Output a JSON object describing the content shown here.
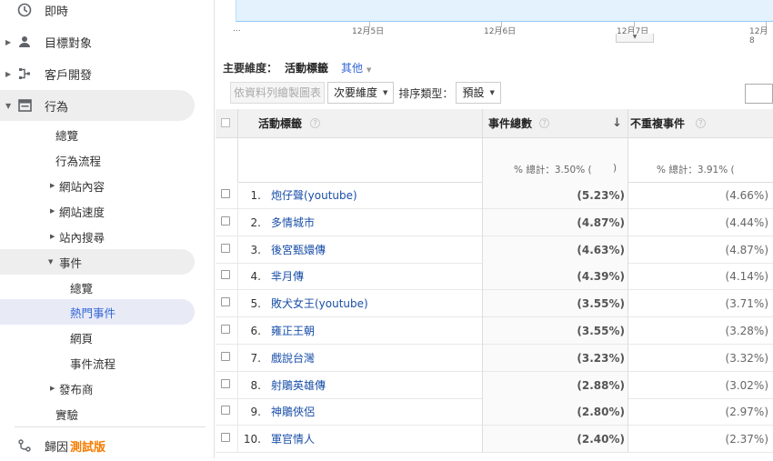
{
  "sidebar": {
    "top_items": [
      {
        "label": "即時",
        "icon": "clock-icon"
      },
      {
        "label": "目標對象",
        "icon": "person-icon"
      },
      {
        "label": "客戶開發",
        "icon": "acquisition-icon"
      },
      {
        "label": "行為",
        "icon": "behavior-icon"
      }
    ],
    "behavior_items": [
      {
        "label": "總覽"
      },
      {
        "label": "行為流程"
      },
      {
        "label": "網站內容"
      },
      {
        "label": "網站速度"
      },
      {
        "label": "站內搜尋"
      },
      {
        "label": "事件"
      }
    ],
    "event_items": [
      {
        "label": "總覽"
      },
      {
        "label": "熱門事件"
      },
      {
        "label": "網頁"
      },
      {
        "label": "事件流程"
      }
    ],
    "after_items": [
      {
        "label": "發布商"
      },
      {
        "label": "實驗"
      }
    ],
    "bottom_item": {
      "label": "歸因",
      "badge": "測試版",
      "icon": "attribution-icon"
    }
  },
  "axis": {
    "start_label": "...",
    "dates": [
      "12月5日",
      "12月6日",
      "12月7日",
      "12月8"
    ]
  },
  "dimension": {
    "label": "主要維度：",
    "current": "活動標籤",
    "other": "其他"
  },
  "toolbar": {
    "plot_rows": "依資料列繪製圖表",
    "secondary": "次要維度",
    "sort_label": "排序類型：",
    "sort_value": "預設"
  },
  "table": {
    "headers": [
      "活動標籤",
      "事件總數",
      "不重複事件"
    ],
    "totals": [
      "% 總計：3.50% (",
      ")",
      "% 總計：3.91% ("
    ],
    "rows": [
      {
        "num": "1.",
        "name": "炮仔聲(youtube)",
        "v1": "(5.23%)",
        "v2": "(4.66%)"
      },
      {
        "num": "2.",
        "name": "多情城市",
        "v1": "(4.87%)",
        "v2": "(4.44%)"
      },
      {
        "num": "3.",
        "name": "後宮甄嬛傳",
        "v1": "(4.63%)",
        "v2": "(4.87%)"
      },
      {
        "num": "4.",
        "name": "芈月傳",
        "v1": "(4.39%)",
        "v2": "(4.14%)"
      },
      {
        "num": "5.",
        "name": "敗犬女王(youtube)",
        "v1": "(3.55%)",
        "v2": "(3.71%)"
      },
      {
        "num": "6.",
        "name": "雍正王朝",
        "v1": "(3.55%)",
        "v2": "(3.28%)"
      },
      {
        "num": "7.",
        "name": "戲說台灣",
        "v1": "(3.23%)",
        "v2": "(3.32%)"
      },
      {
        "num": "8.",
        "name": "射鵰英雄傳",
        "v1": "(2.88%)",
        "v2": "(3.02%)"
      },
      {
        "num": "9.",
        "name": "神鵰俠侶",
        "v1": "(2.80%)",
        "v2": "(2.97%)"
      },
      {
        "num": "10.",
        "name": "軍官情人",
        "v1": "(2.40%)",
        "v2": "(2.37%)"
      }
    ]
  }
}
